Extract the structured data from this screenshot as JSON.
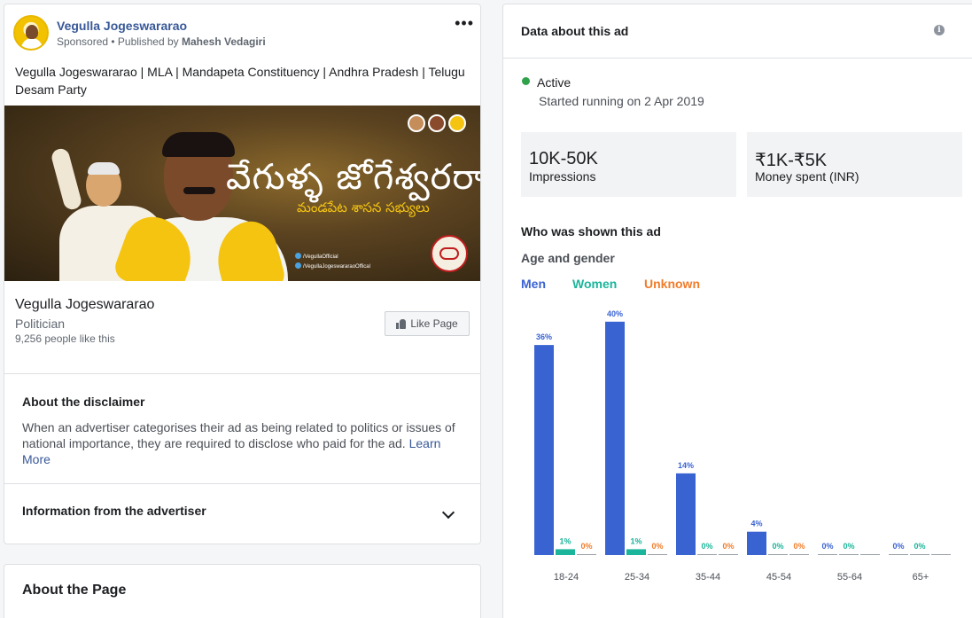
{
  "ad": {
    "page_name": "Vegulla Jogeswararao",
    "sponsored": "Sponsored",
    "published_prefix": " • Published by ",
    "publisher": "Mahesh Vedagiri",
    "more_label": "•••",
    "body_text": "Vegulla Jogeswararao | MLA | Mandapeta Constituency | Andhra Pradesh | Telugu Desam Party",
    "banner": {
      "title": "వేగుళ్ళ జోగేశ్వరరావు",
      "subtitle": "మండపేట శాసన సభ్యులు",
      "social_1": "/VegullaOfficial",
      "social_2": "/VegullaJogeswararaoOffical"
    },
    "page_info": {
      "name": "Vegulla Jogeswararao",
      "category": "Politician",
      "likes": "9,256 people like this",
      "like_button": "Like Page"
    },
    "disclaimer": {
      "title": "About the disclaimer",
      "text": "When an advertiser categorises their ad as being related to politics or issues of national importance, they are required to disclose who paid for the ad. ",
      "learn_more": "Learn More"
    },
    "advertiser_info_title": "Information from the advertiser",
    "about_page_title": "About the Page"
  },
  "data_panel": {
    "title": "Data about this ad",
    "info_icon": "i",
    "status": "Active",
    "started": "Started running on 2 Apr 2019",
    "impressions_value": "10K-50K",
    "impressions_label": "Impressions",
    "spend_value": "₹1K-₹5K",
    "spend_label": "Money spent (INR)",
    "who_title": "Who was shown this ad",
    "age_gender_title": "Age and gender",
    "legend": {
      "men": "Men",
      "women": "Women",
      "unknown": "Unknown"
    }
  },
  "colors": {
    "men": "#3a63d2",
    "women": "#1ab59a",
    "unknown": "#f07c2a",
    "link": "#385898",
    "active": "#31a24c"
  },
  "chart_data": {
    "type": "bar",
    "categories": [
      "18-24",
      "25-34",
      "35-44",
      "45-54",
      "55-64",
      "65+"
    ],
    "series": [
      {
        "name": "Men",
        "values": [
          36,
          40,
          14,
          4,
          0,
          0
        ],
        "labels": [
          "36%",
          "40%",
          "14%",
          "4%",
          "0%",
          "0%"
        ]
      },
      {
        "name": "Women",
        "values": [
          1,
          1,
          0,
          0,
          0,
          0
        ],
        "labels": [
          "1%",
          "1%",
          "0%",
          "0%",
          "0%",
          "0%"
        ]
      },
      {
        "name": "Unknown",
        "values": [
          0,
          0,
          0,
          0,
          0,
          0
        ],
        "labels": [
          "0%",
          "0%",
          "0%",
          "0%",
          "",
          ""
        ]
      }
    ],
    "ylim": [
      0,
      40
    ]
  }
}
